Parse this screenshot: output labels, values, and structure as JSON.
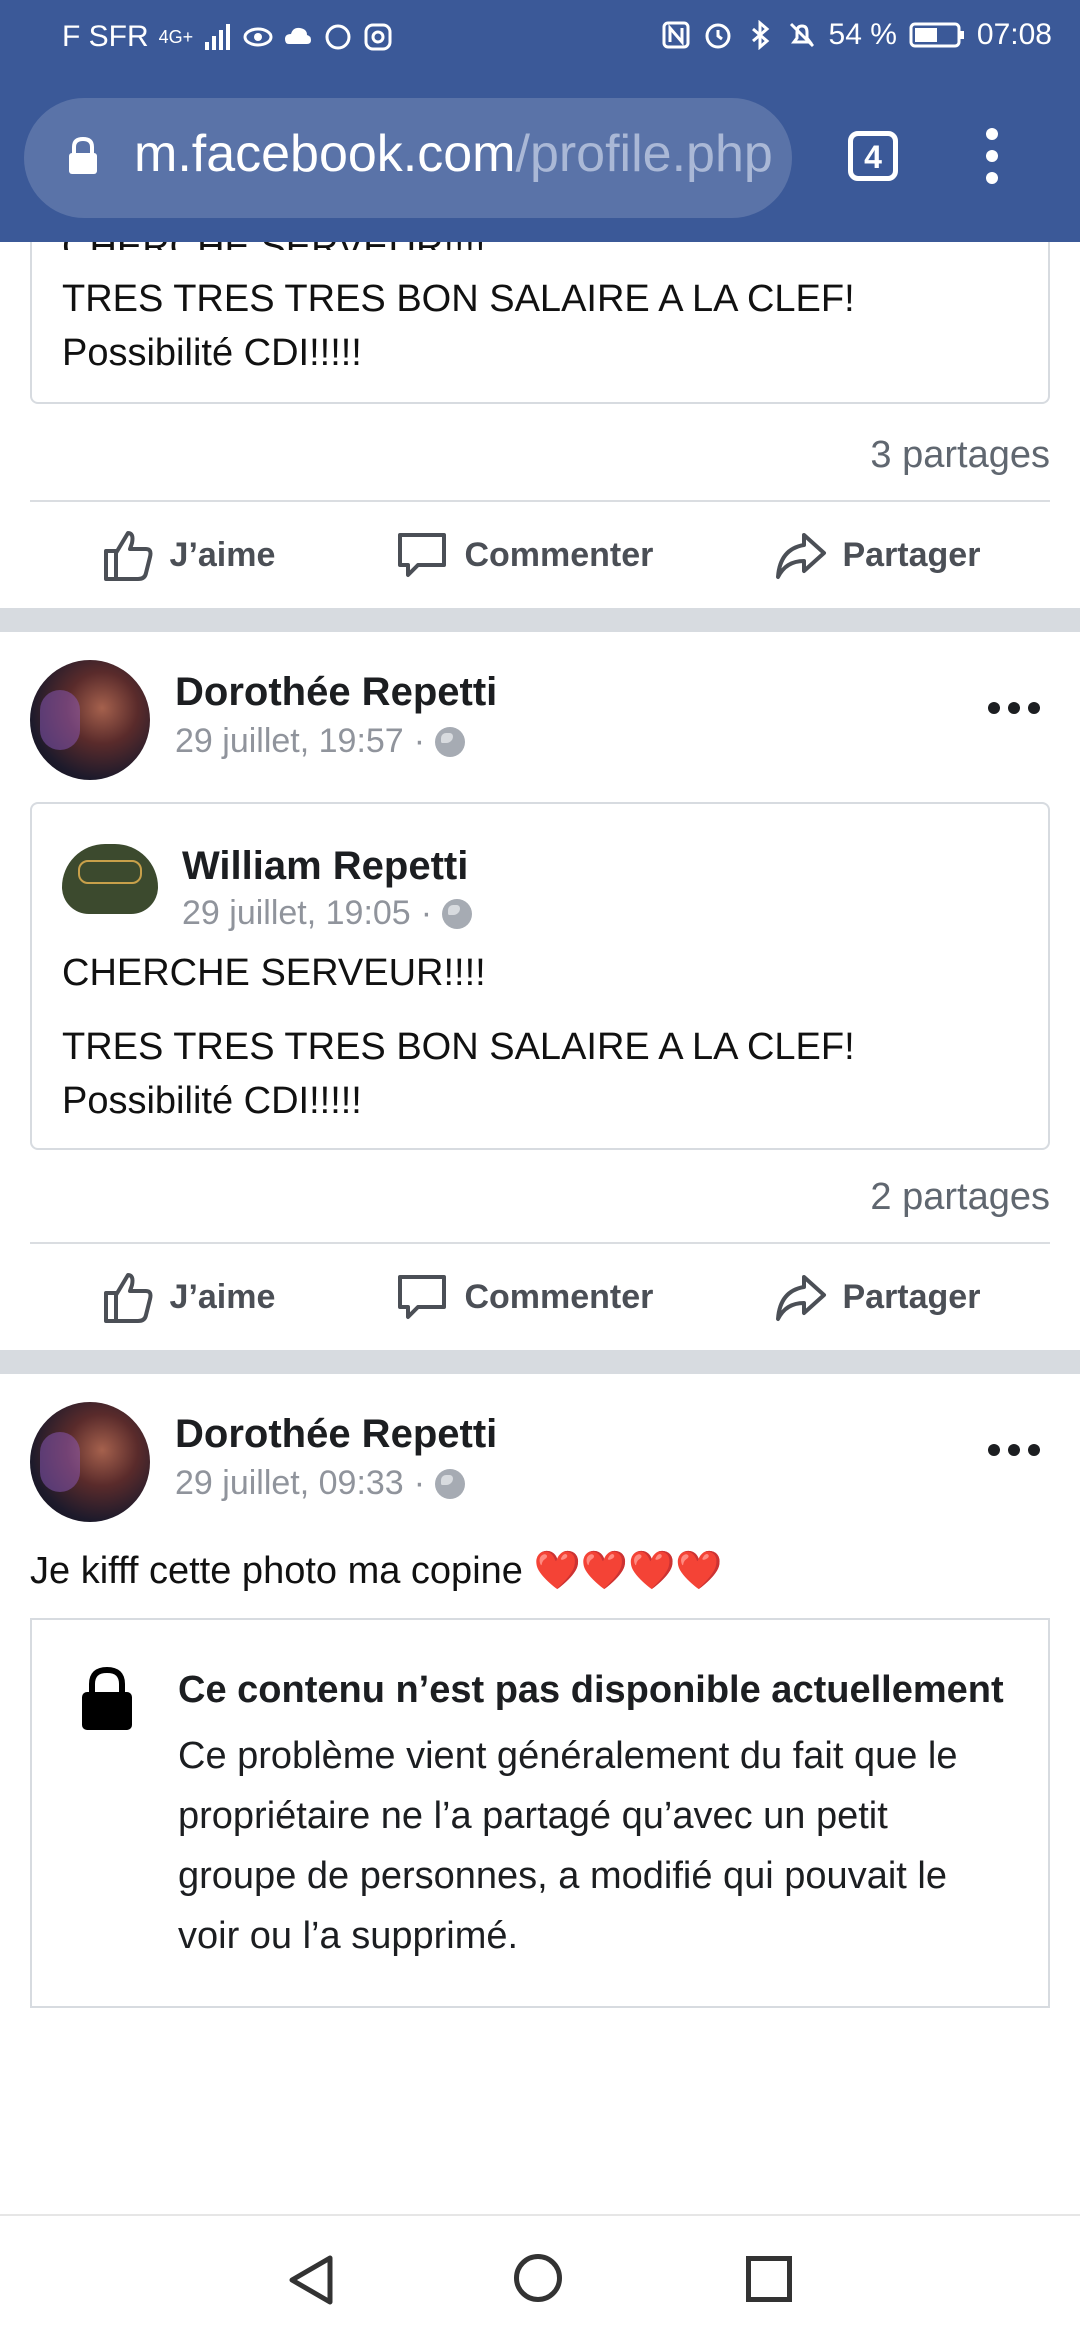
{
  "status_bar": {
    "carrier": "F SFR",
    "network": "4G+",
    "battery": "54 %",
    "time": "07:08"
  },
  "browser": {
    "url_domain": "m.facebook.com",
    "url_path": "/profile.php?i",
    "tab_count": "4"
  },
  "posts": [
    {
      "partial_text_top": "CHERCHE SERVEUR!!!!",
      "text_lines": [
        "TRES TRES TRES BON SALAIRE A LA CLEF!",
        "Possibilité CDI!!!!!"
      ],
      "shares": "3 partages"
    },
    {
      "author": "Dorothée Repetti",
      "date": "29 juillet, 19:57",
      "shared": {
        "author": "William Repetti",
        "date": "29 juillet, 19:05",
        "line1": "CHERCHE SERVEUR!!!!",
        "line2": "TRES TRES TRES BON SALAIRE A LA CLEF!",
        "line3": "Possibilité CDI!!!!!"
      },
      "shares": "2 partages"
    },
    {
      "author": "Dorothée Repetti",
      "date": "29 juillet, 09:33",
      "text": "Je kifff cette photo ma copine ❤️❤️❤️❤️",
      "unavailable_title": "Ce contenu n’est pas disponible actuellement",
      "unavailable_body": "Ce problème vient généralement du fait que le propriétaire ne l’a partagé qu’avec un petit groupe de personnes, a modifié qui pouvait le voir ou l’a supprimé."
    }
  ],
  "actions": {
    "like": "J’aime",
    "comment": "Commenter",
    "share": "Partager"
  },
  "icons": {
    "like": "thumbs-up-icon",
    "comment": "speech-bubble-icon",
    "share": "share-arrow-icon",
    "lock": "lock-icon",
    "globe": "globe-icon",
    "more": "more-dots-icon"
  },
  "colors": {
    "facebook_blue": "#3b5998",
    "action_gray": "#4b4f56",
    "meta_gray": "#90949c"
  }
}
